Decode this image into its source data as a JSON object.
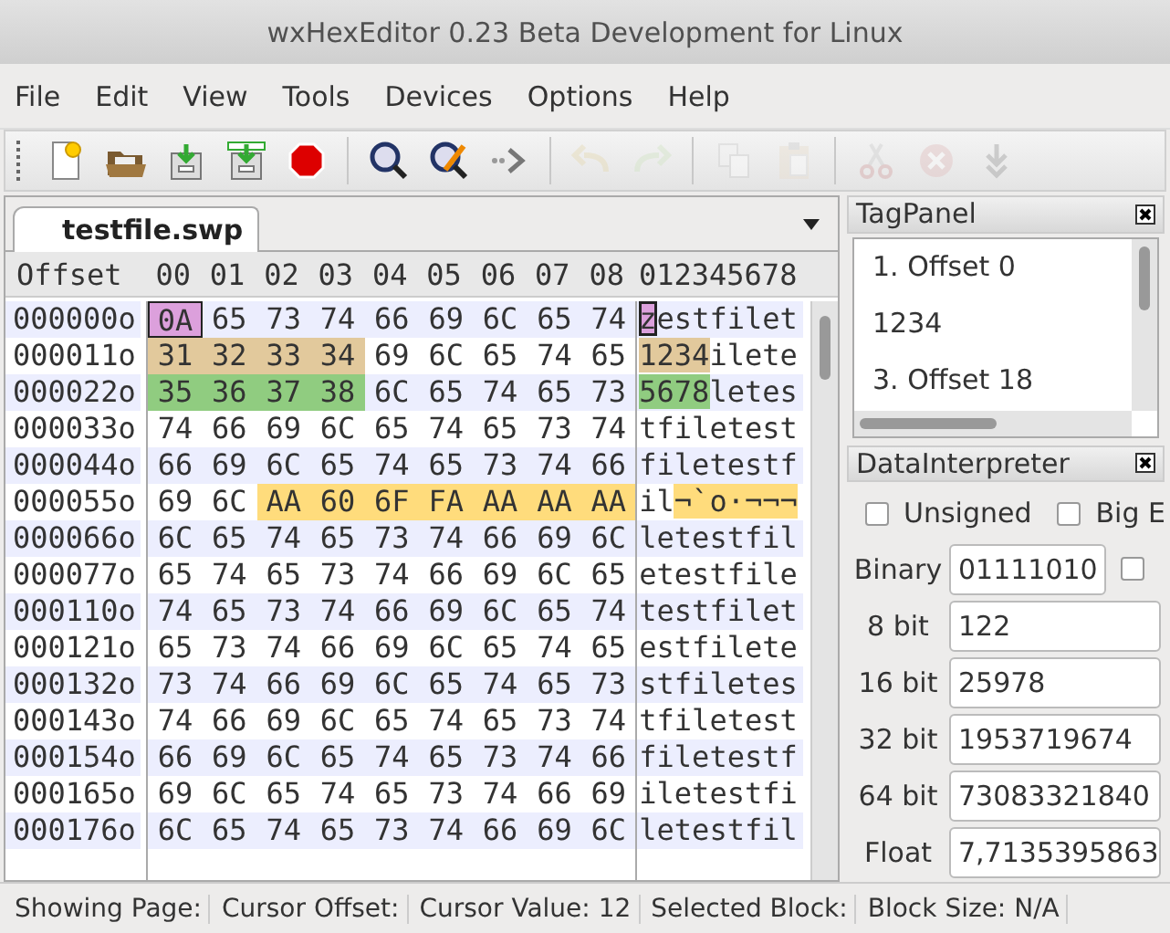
{
  "window": {
    "title": "wxHexEditor 0.23 Beta Development for Linux"
  },
  "menu": [
    "File",
    "Edit",
    "View",
    "Tools",
    "Devices",
    "Options",
    "Help"
  ],
  "toolbar": [
    {
      "kind": "new",
      "disabled": false
    },
    {
      "kind": "open",
      "disabled": false
    },
    {
      "kind": "save",
      "disabled": false
    },
    {
      "kind": "saveas",
      "disabled": false
    },
    {
      "kind": "stop",
      "disabled": false
    },
    {
      "kind": "sep"
    },
    {
      "kind": "find",
      "disabled": false
    },
    {
      "kind": "replace",
      "disabled": false
    },
    {
      "kind": "goto",
      "disabled": false
    },
    {
      "kind": "sep"
    },
    {
      "kind": "undo",
      "disabled": true
    },
    {
      "kind": "redo",
      "disabled": true
    },
    {
      "kind": "sep"
    },
    {
      "kind": "copy",
      "disabled": true
    },
    {
      "kind": "paste",
      "disabled": true
    },
    {
      "kind": "sep"
    },
    {
      "kind": "cut",
      "disabled": true
    },
    {
      "kind": "delete",
      "disabled": true
    },
    {
      "kind": "insert",
      "disabled": true
    }
  ],
  "tabs": [
    {
      "label": "testfile.swp",
      "selected": true
    }
  ],
  "hex_header": {
    "offset": "Offset",
    "columns": [
      "00",
      "01",
      "02",
      "03",
      "04",
      "05",
      "06",
      "07",
      "08"
    ],
    "text": "012345678"
  },
  "rows": [
    {
      "offset": "000000o",
      "hex": [
        {
          "bytes": [
            "0A"
          ],
          "color": "#dca0dc",
          "cursor": true
        },
        {
          "bytes": [
            "65",
            "73",
            "74",
            "66",
            "69",
            "6C",
            "65",
            "74"
          ]
        }
      ],
      "text": [
        {
          "text": "z",
          "color": "#dca0dc",
          "cursor": true
        },
        {
          "text": "estfilet"
        }
      ]
    },
    {
      "offset": "000011o",
      "hex": [
        {
          "bytes": [
            "31",
            "32",
            "33",
            "34"
          ],
          "color": "#e2c99c"
        },
        {
          "bytes": [
            "69",
            "6C",
            "65",
            "74",
            "65"
          ]
        }
      ],
      "text": [
        {
          "text": "1234",
          "color": "#e2c99c"
        },
        {
          "text": "ilete"
        }
      ]
    },
    {
      "offset": "000022o",
      "hex": [
        {
          "bytes": [
            "35",
            "36",
            "37",
            "38"
          ],
          "color": "#90cc80"
        },
        {
          "bytes": [
            "6C",
            "65",
            "74",
            "65",
            "73"
          ]
        }
      ],
      "text": [
        {
          "text": "5678",
          "color": "#90cc80"
        },
        {
          "text": "letes"
        }
      ]
    },
    {
      "offset": "000033o",
      "hex": [
        {
          "bytes": [
            "74",
            "66",
            "69",
            "6C",
            "65",
            "74",
            "65",
            "73",
            "74"
          ]
        }
      ],
      "text": [
        {
          "text": "tfiletest"
        }
      ]
    },
    {
      "offset": "000044o",
      "hex": [
        {
          "bytes": [
            "66",
            "69",
            "6C",
            "65",
            "74",
            "65",
            "73",
            "74",
            "66"
          ]
        }
      ],
      "text": [
        {
          "text": "filetestf"
        }
      ]
    },
    {
      "offset": "000055o",
      "hex": [
        {
          "bytes": [
            "69",
            "6C"
          ]
        },
        {
          "bytes": [
            "AA",
            "60",
            "6F",
            "FA",
            "AA",
            "AA",
            "AA"
          ],
          "color": "#ffdc7c"
        }
      ],
      "text": [
        {
          "text": "il"
        },
        {
          "text": "¬`o·¬¬¬",
          "color": "#ffdc7c"
        }
      ]
    },
    {
      "offset": "000066o",
      "hex": [
        {
          "bytes": [
            "6C",
            "65",
            "74",
            "65",
            "73",
            "74",
            "66",
            "69",
            "6C"
          ]
        }
      ],
      "text": [
        {
          "text": "letestfil"
        }
      ]
    },
    {
      "offset": "000077o",
      "hex": [
        {
          "bytes": [
            "65",
            "74",
            "65",
            "73",
            "74",
            "66",
            "69",
            "6C",
            "65"
          ]
        }
      ],
      "text": [
        {
          "text": "etestfile"
        }
      ]
    },
    {
      "offset": "000110o",
      "hex": [
        {
          "bytes": [
            "74",
            "65",
            "73",
            "74",
            "66",
            "69",
            "6C",
            "65",
            "74"
          ]
        }
      ],
      "text": [
        {
          "text": "testfilet"
        }
      ]
    },
    {
      "offset": "000121o",
      "hex": [
        {
          "bytes": [
            "65",
            "73",
            "74",
            "66",
            "69",
            "6C",
            "65",
            "74",
            "65"
          ]
        }
      ],
      "text": [
        {
          "text": "estfilete"
        }
      ]
    },
    {
      "offset": "000132o",
      "hex": [
        {
          "bytes": [
            "73",
            "74",
            "66",
            "69",
            "6C",
            "65",
            "74",
            "65",
            "73"
          ]
        }
      ],
      "text": [
        {
          "text": "stfiletes"
        }
      ]
    },
    {
      "offset": "000143o",
      "hex": [
        {
          "bytes": [
            "74",
            "66",
            "69",
            "6C",
            "65",
            "74",
            "65",
            "73",
            "74"
          ]
        }
      ],
      "text": [
        {
          "text": "tfiletest"
        }
      ]
    },
    {
      "offset": "000154o",
      "hex": [
        {
          "bytes": [
            "66",
            "69",
            "6C",
            "65",
            "74",
            "65",
            "73",
            "74",
            "66"
          ]
        }
      ],
      "text": [
        {
          "text": "filetestf"
        }
      ]
    },
    {
      "offset": "000165o",
      "hex": [
        {
          "bytes": [
            "69",
            "6C",
            "65",
            "74",
            "65",
            "73",
            "74",
            "66",
            "69"
          ]
        }
      ],
      "text": [
        {
          "text": "iletestfi"
        }
      ]
    },
    {
      "offset": "000176o",
      "hex": [
        {
          "bytes": [
            "6C",
            "65",
            "74",
            "65",
            "73",
            "74",
            "66",
            "69",
            "6C"
          ]
        }
      ],
      "text": [
        {
          "text": "letestfil"
        }
      ]
    }
  ],
  "tag_panel": {
    "title": "TagPanel",
    "items": [
      "1. Offset 0",
      "1234",
      "3. Offset 18"
    ]
  },
  "data_interpreter": {
    "title": "DataInterpreter",
    "options": [
      {
        "label": "Unsigned",
        "checked": false
      },
      {
        "label": "Big E",
        "checked": false
      }
    ],
    "fields": [
      {
        "label": "Binary",
        "value": "01111010",
        "kind": "binary",
        "checked": false
      },
      {
        "label": "8 bit",
        "value": "122",
        "kind": "plain"
      },
      {
        "label": "16 bit",
        "value": "25978",
        "kind": "plain"
      },
      {
        "label": "32 bit",
        "value": "1953719674",
        "kind": "plain"
      },
      {
        "label": "64 bit",
        "value": "73083321840",
        "kind": "plain"
      },
      {
        "label": "Float",
        "value": "7,7135395863",
        "kind": "plain"
      }
    ]
  },
  "status_bar": [
    "Showing Page:",
    "Cursor Offset:",
    "Cursor Value: 12",
    "Selected Block:",
    "Block Size: N/A"
  ]
}
